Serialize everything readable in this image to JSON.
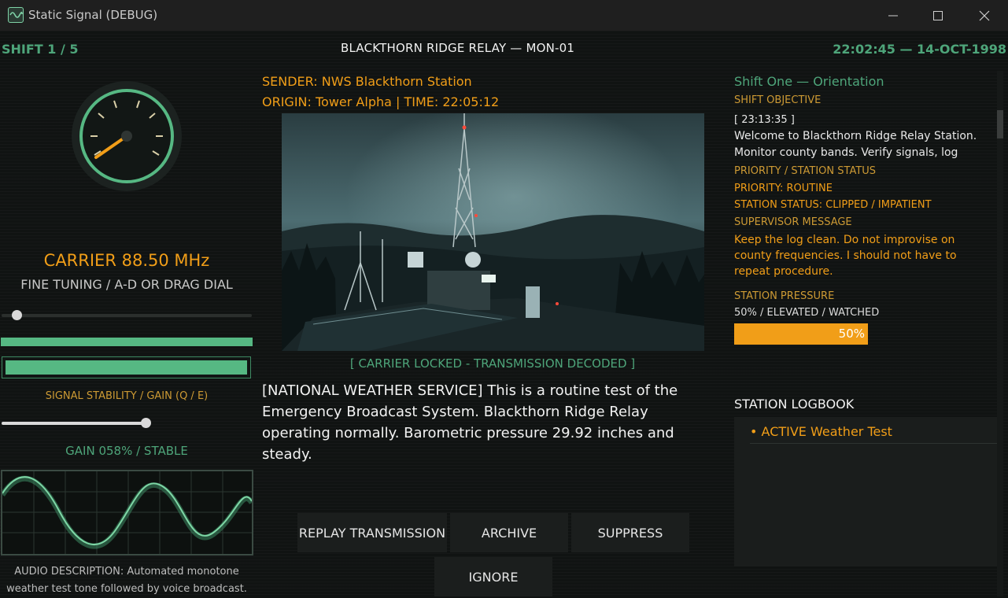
{
  "window": {
    "title": "Static Signal (DEBUG)"
  },
  "header": {
    "shift": "SHIFT 1 / 5",
    "station": "BLACKTHORN RIDGE RELAY — MON-01",
    "clock": "22:02:45 — 14-OCT-1998"
  },
  "tuner": {
    "carrier": "CARRIER  88.50 MHz",
    "fine_tuning": "FINE TUNING  /  A-D OR DRAG DIAL",
    "tuning_level": 0.06,
    "signal_strength": 1.0,
    "stability_label": "SIGNAL STABILITY / GAIN  (Q / E)",
    "gain_level": 0.58,
    "gain_status": "GAIN 058%  /  STABLE",
    "audio_description": "AUDIO DESCRIPTION: Automated monotone weather test tone followed by voice broadcast."
  },
  "transmission": {
    "sender": "SENDER: NWS Blackthorn Station",
    "origin": "ORIGIN: Tower Alpha  |  TIME: 22:05:12",
    "status": "[ CARRIER LOCKED - TRANSMISSION DECODED ]",
    "message": "[NATIONAL WEATHER SERVICE] This is a routine test of the Emergency Broadcast System. Blackthorn Ridge Relay operating normally. Barometric pressure 29.92 inches and steady."
  },
  "actions": {
    "replay": "REPLAY TRANSMISSION",
    "archive": "ARCHIVE",
    "suppress": "SUPPRESS",
    "ignore": "IGNORE"
  },
  "briefing": {
    "shift_title": "Shift One — Orientation",
    "objective_label": "SHIFT OBJECTIVE",
    "objective_time": "[ 23:13:35 ]",
    "objective_text": "Welcome to Blackthorn Ridge Relay Station. Monitor county bands. Verify signals, log",
    "priority_label": "PRIORITY / STATION STATUS",
    "priority": "PRIORITY: ROUTINE",
    "station_status": "STATION STATUS: CLIPPED / IMPATIENT",
    "supervisor_label": "SUPERVISOR MESSAGE",
    "supervisor_message": "Keep the log clean. Do not improvise on county frequencies. I should not have to repeat procedure.",
    "pressure_label": "STATION PRESSURE",
    "pressure_status": "50% / ELEVATED / WATCHED",
    "pressure_value": 0.5,
    "pressure_percent": "50%"
  },
  "logbook": {
    "title": "STATION LOGBOOK",
    "entries": [
      {
        "text": "• ACTIVE  Weather Test"
      }
    ]
  },
  "colors": {
    "accent_green": "#4ea57a",
    "bright_green": "#56b883",
    "amber": "#f19e18",
    "background": "#101312"
  },
  "icons": {
    "app": "waveform-icon",
    "minimize": "minimize-icon",
    "maximize": "maximize-icon",
    "close": "close-icon"
  }
}
